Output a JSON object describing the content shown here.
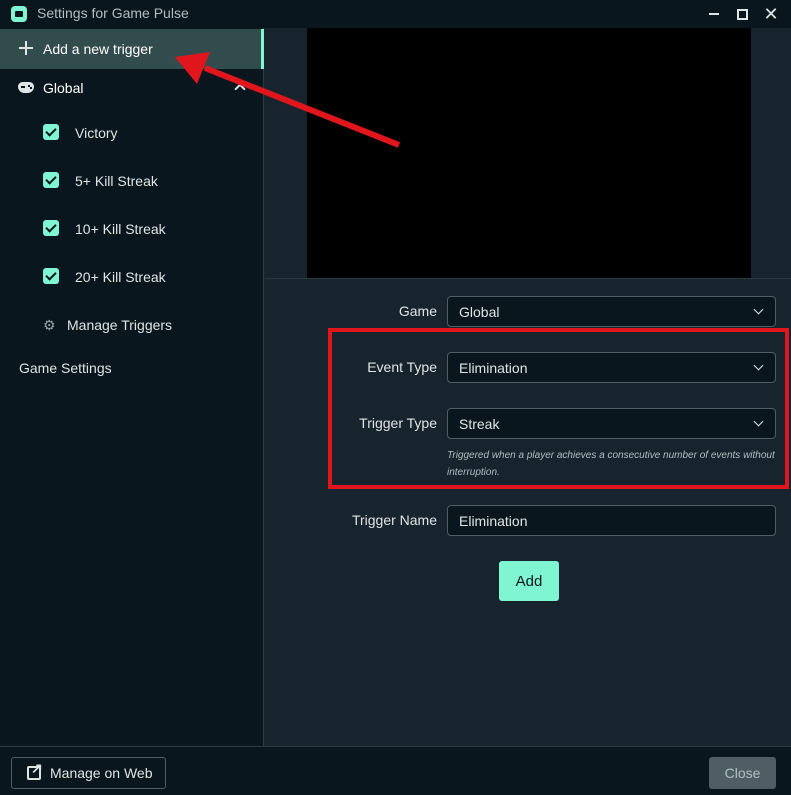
{
  "window": {
    "title": "Settings for Game Pulse",
    "close_glyph": "✕"
  },
  "sidebar": {
    "add_trigger_label": "Add a new trigger",
    "group_label": "Global",
    "items": [
      {
        "label": "Victory",
        "checked": true
      },
      {
        "label": "5+ Kill Streak",
        "checked": true
      },
      {
        "label": "10+ Kill Streak",
        "checked": true
      },
      {
        "label": "20+ Kill Streak",
        "checked": true
      }
    ],
    "manage_label": "Manage Triggers",
    "game_settings_label": "Game Settings"
  },
  "form": {
    "game_label": "Game",
    "game_value": "Global",
    "event_type_label": "Event Type",
    "event_type_value": "Elimination",
    "trigger_type_label": "Trigger Type",
    "trigger_type_value": "Streak",
    "trigger_type_desc": "Triggered when a player achieves a consecutive number of events without interruption.",
    "trigger_name_label": "Trigger Name",
    "trigger_name_value": "Elimination",
    "add_label": "Add"
  },
  "footer": {
    "manage_web_label": "Manage on Web",
    "close_label": "Close"
  },
  "colors": {
    "accent": "#80f5d2",
    "annotation": "#e0161c",
    "background": "#17242d",
    "sidebar": "#09161d"
  }
}
